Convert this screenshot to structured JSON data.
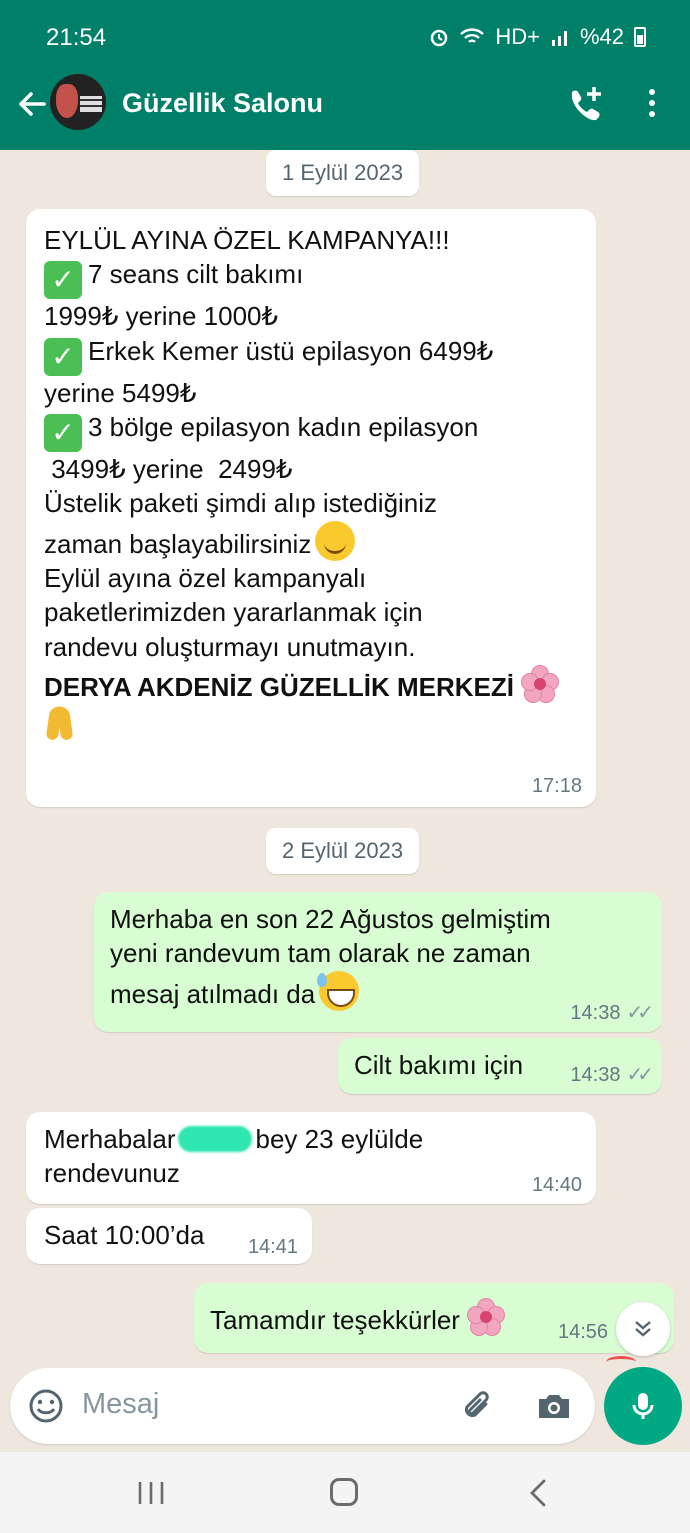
{
  "status_bar": {
    "time": "21:54",
    "network": "HD+",
    "battery": "%42"
  },
  "header": {
    "title": "Güzellik Salonu"
  },
  "messages": {
    "date1": "1 Eylül 2023",
    "campaign": {
      "l1": "EYLÜL AYINA ÖZEL KAMPANYA!!!",
      "l2": "7 seans cilt bakımı",
      "l3": "1999₺ yerine 1000₺",
      "l4": "Erkek Kemer üstü epilasyon 6499₺",
      "l5": "yerine 5499₺",
      "l6": "3 bölge epilasyon kadın epilasyon",
      "l7": " 3499₺ yerine  2499₺",
      "l8": "Üstelik paketi şimdi alıp istediğiniz",
      "l9": "zaman başlayabilirsiniz",
      "l10": "Eylül ayına özel kampanyalı",
      "l11": "paketlerimizden yararlanmak için",
      "l12": "randevu oluşturmayı unutmayın.",
      "l13": "DERYA AKDENİZ GÜZELLİK MERKEZİ",
      "time": "17:18"
    },
    "date2": "2 Eylül 2023",
    "out1": {
      "l1": "Merhaba en son 22 Ağustos gelmiştim",
      "l2": "yeni randevum tam olarak ne zaman",
      "l3": "mesaj atılmadı da",
      "time": "14:38"
    },
    "out2": {
      "text": "Cilt bakımı için",
      "time": "14:38"
    },
    "in2": {
      "p1": "Merhabalar",
      "p2": "bey 23 eylülde",
      "l2": "rendevunuz",
      "time": "14:40"
    },
    "in3": {
      "text": "Saat 10:00’da",
      "time": "14:41"
    },
    "out3": {
      "text": "Tamamdır teşekkürler",
      "time": "14:56"
    },
    "ticks": "✓✓"
  },
  "input": {
    "placeholder": "Mesaj"
  },
  "icons": [
    "back-arrow-icon",
    "call-add-icon",
    "more-vert-icon",
    "check-icon",
    "smile-icon",
    "flower-icon",
    "pray-icon",
    "sweat-smile-icon",
    "emoji-icon",
    "attach-icon",
    "camera-icon",
    "mic-icon",
    "chevron-down-icon"
  ],
  "colors": {
    "header": "#008069",
    "outgoing": "#d9fdd3",
    "incoming": "#ffffff",
    "background": "#efe7dd",
    "accent": "#00a884"
  }
}
